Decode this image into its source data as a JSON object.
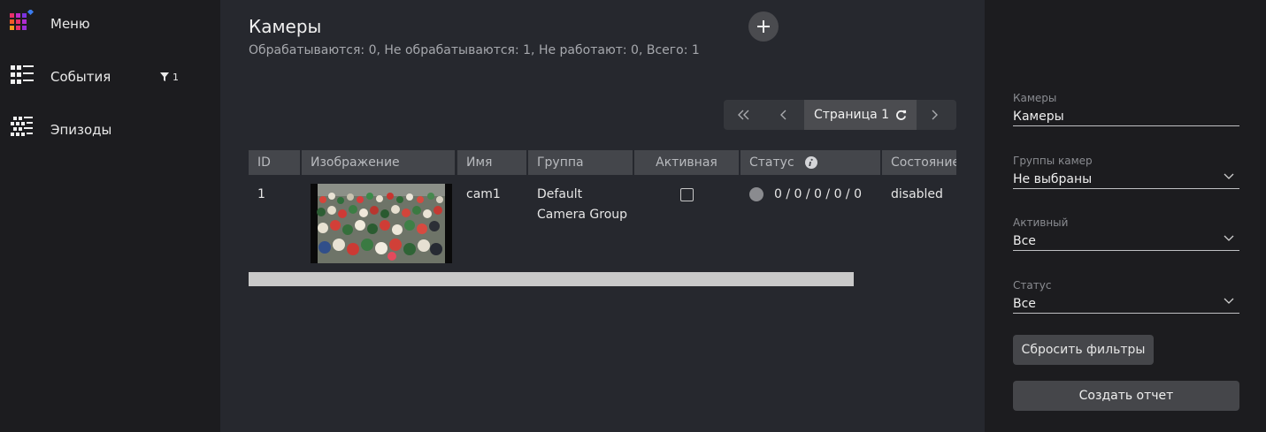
{
  "sidebar": {
    "items": [
      {
        "label": "Меню",
        "icon": "menu-grid-icon"
      },
      {
        "label": "События",
        "icon": "events-list-icon",
        "filter_count": "1"
      },
      {
        "label": "Эпизоды",
        "icon": "episodes-icon"
      }
    ]
  },
  "main": {
    "title": "Камеры",
    "summary": "Обрабатываются: 0, Не обрабатываются: 1, Не работают: 0, Всего: 1",
    "add_icon": "plus-icon",
    "pager": {
      "page_label": "Страница 1"
    },
    "table": {
      "headers": [
        "ID",
        "Изображение",
        "Имя",
        "Группа",
        "Активная",
        "Статус",
        "Состояние"
      ],
      "rows": [
        {
          "id": "1",
          "name": "cam1",
          "group_line1": "Default",
          "group_line2": "Camera Group",
          "active": false,
          "status": "0 / 0 / 0 / 0 / 0",
          "state": "disabled"
        }
      ]
    }
  },
  "filters": {
    "cameras": {
      "label": "Камеры",
      "placeholder": "Камеры"
    },
    "groups": {
      "label": "Группы камер",
      "value": "Не выбраны"
    },
    "active": {
      "label": "Активный",
      "value": "Все"
    },
    "status": {
      "label": "Статус",
      "value": "Все"
    },
    "reset_label": "Сбросить фильтры",
    "report_label": "Создать отчет"
  },
  "colors": {
    "sidebar_bg": "#1c1c1f",
    "main_bg": "#26282e",
    "header_bg": "#44464b",
    "button_bg": "#45464a"
  }
}
